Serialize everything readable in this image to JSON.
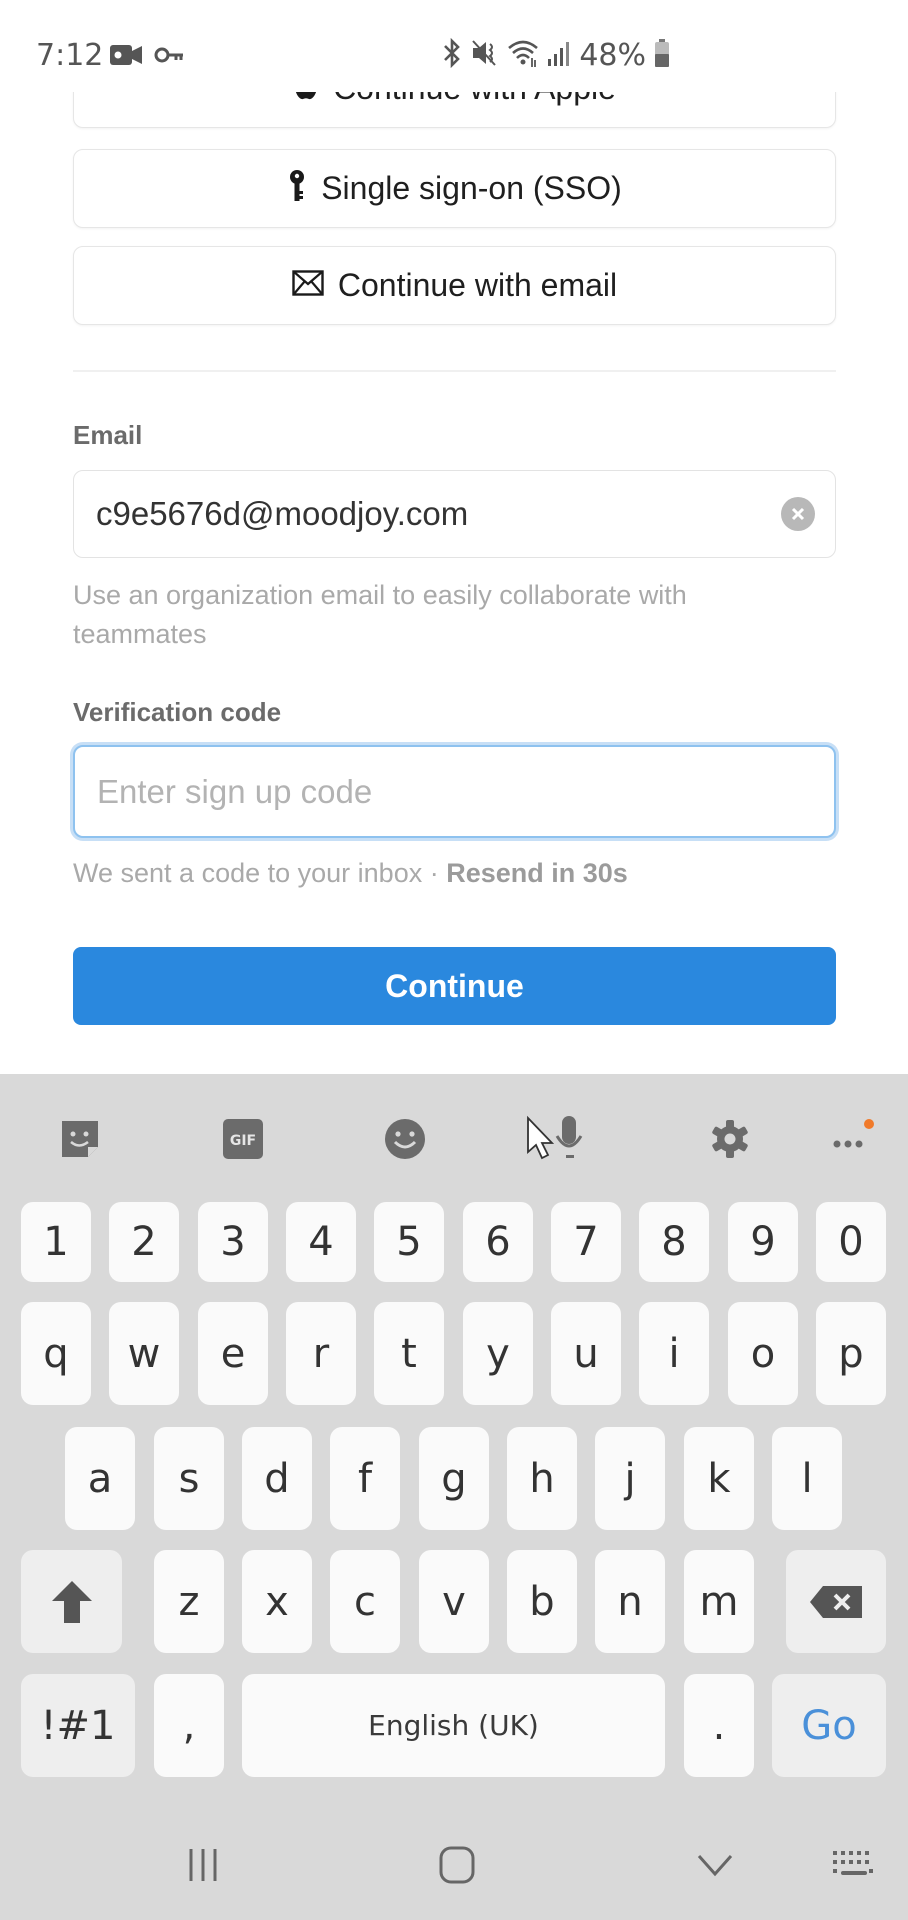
{
  "status_bar": {
    "time": "7:12",
    "left_icons": [
      "video-camera-icon",
      "key-icon"
    ],
    "right_icons": [
      "bluetooth-icon",
      "vibrate-mute-icon",
      "wifi-icon",
      "signal-icon"
    ],
    "battery_percent": "48%"
  },
  "auth_options": [
    {
      "icon": "apple-icon",
      "label": "Continue with Apple"
    },
    {
      "icon": "key-icon",
      "label": "Single sign-on (SSO)"
    },
    {
      "icon": "envelope-icon",
      "label": "Continue with email"
    }
  ],
  "email_field": {
    "label": "Email",
    "value": "c9e5676d@moodjoy.com",
    "helper": "Use an organization email to easily collaborate with teammates"
  },
  "code_field": {
    "label": "Verification code",
    "placeholder": "Enter sign up code",
    "hint": "We sent a code to your inbox · ",
    "resend": "Resend in 30s"
  },
  "continue_button": {
    "label": "Continue",
    "color": "#2a88de"
  },
  "keyboard": {
    "toolbar": [
      "sticker-icon",
      "gif-icon",
      "emoji-icon",
      "microphone-icon",
      "settings-icon",
      "more-icon"
    ],
    "gif_label": "GIF",
    "row_numbers": [
      "1",
      "2",
      "3",
      "4",
      "5",
      "6",
      "7",
      "8",
      "9",
      "0"
    ],
    "row_1": [
      "q",
      "w",
      "e",
      "r",
      "t",
      "y",
      "u",
      "i",
      "o",
      "p"
    ],
    "row_2": [
      "a",
      "s",
      "d",
      "f",
      "g",
      "h",
      "j",
      "k",
      "l"
    ],
    "row_3": [
      "z",
      "x",
      "c",
      "v",
      "b",
      "n",
      "m"
    ],
    "symbols_key": "!#1",
    "comma_key": ",",
    "space_label": "English (UK)",
    "period_key": ".",
    "action_key": "Go",
    "action_color": "#4a90d9",
    "notification_dot_color": "#f07a2a"
  },
  "nav_bar": [
    "recent-apps-icon",
    "home-icon",
    "hide-keyboard-icon",
    "keyboard-switch-icon"
  ]
}
